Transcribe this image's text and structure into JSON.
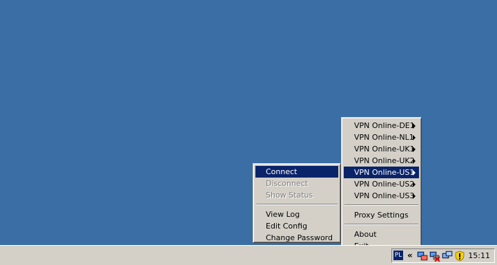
{
  "servers_menu": {
    "items": [
      {
        "label": "VPN Online-DE1"
      },
      {
        "label": "VPN Online-NL1"
      },
      {
        "label": "VPN Online-UK1"
      },
      {
        "label": "VPN Online-UK2"
      },
      {
        "label": "VPN Online-US1"
      },
      {
        "label": "VPN Online-US2"
      },
      {
        "label": "VPN Online-US3"
      }
    ],
    "proxy_settings": "Proxy Settings",
    "about": "About",
    "exit": "Exit"
  },
  "context_menu": {
    "connect": "Connect",
    "disconnect": "Disconnect",
    "show_status": "Show Status",
    "view_log": "View Log",
    "edit_config": "Edit Config",
    "change_password": "Change Password"
  },
  "taskbar": {
    "language": "PL",
    "expand": "«",
    "clock": "15:11",
    "tray_icons": [
      "network-icon",
      "network-disconnected-icon",
      "network-icon",
      "security-shield-icon"
    ]
  },
  "colors": {
    "desktop": "#3a6ea5",
    "menu_bg": "#d4d0c8",
    "highlight": "#0a246a"
  }
}
